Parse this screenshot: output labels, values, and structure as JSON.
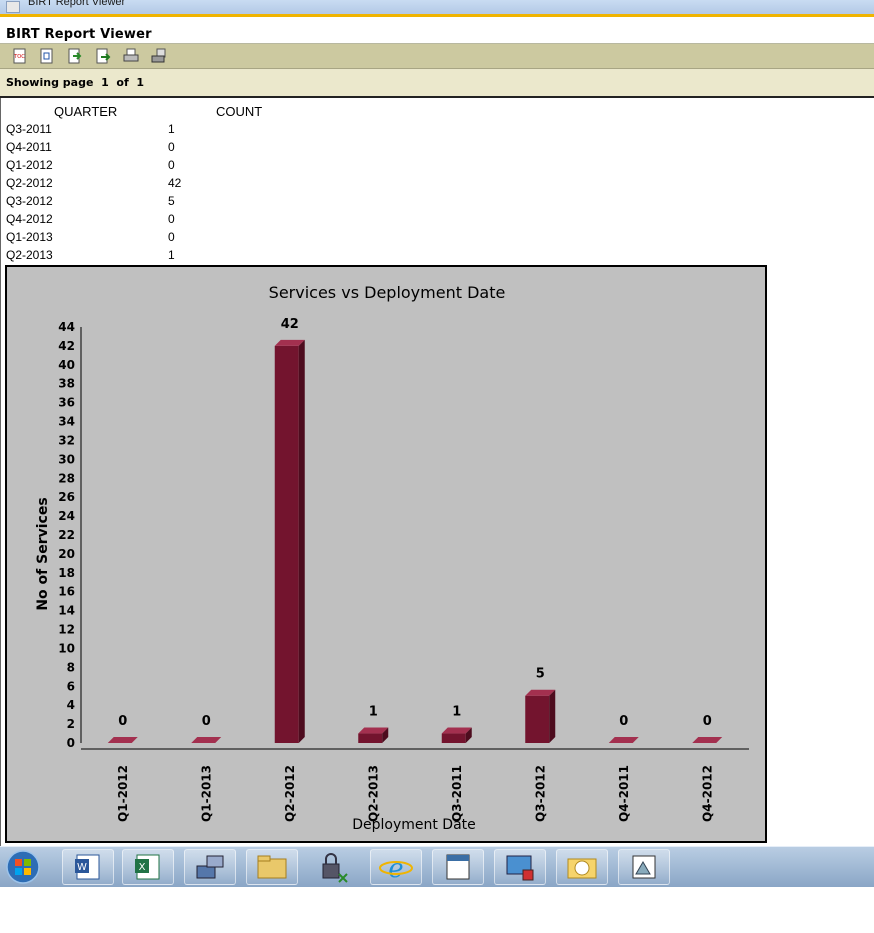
{
  "window": {
    "title": "BIRT Report Viewer"
  },
  "header": {
    "title": "BIRT Report Viewer"
  },
  "toolbar": {
    "buttons": [
      {
        "icon": "toc-icon"
      },
      {
        "icon": "parameters-icon"
      },
      {
        "icon": "export-data-icon"
      },
      {
        "icon": "export-report-icon"
      },
      {
        "icon": "print-icon"
      },
      {
        "icon": "print-server-icon"
      }
    ]
  },
  "pagebar": {
    "text": "Showing page  1  of  1"
  },
  "table": {
    "headers": {
      "quarter": "QUARTER",
      "count": "COUNT"
    },
    "rows": [
      {
        "quarter": "Q3-2011",
        "count": "1"
      },
      {
        "quarter": "Q4-2011",
        "count": "0"
      },
      {
        "quarter": "Q1-2012",
        "count": "0"
      },
      {
        "quarter": "Q2-2012",
        "count": "42"
      },
      {
        "quarter": "Q3-2012",
        "count": "5"
      },
      {
        "quarter": "Q4-2012",
        "count": "0"
      },
      {
        "quarter": "Q1-2013",
        "count": "0"
      },
      {
        "quarter": "Q2-2013",
        "count": "1"
      }
    ]
  },
  "chart_data": {
    "type": "bar",
    "title": "Services vs Deployment Date",
    "xlabel": "Deployment Date",
    "ylabel": "No of Services",
    "categories": [
      "Q1-2012",
      "Q1-2013",
      "Q2-2012",
      "Q2-2013",
      "Q3-2011",
      "Q3-2012",
      "Q4-2011",
      "Q4-2012"
    ],
    "values": [
      0,
      0,
      42,
      1,
      1,
      5,
      0,
      0
    ],
    "ylim": [
      0,
      44
    ],
    "yticks": [
      "0",
      "2",
      "4",
      "6",
      "8",
      "10",
      "12",
      "14",
      "16",
      "18",
      "20",
      "22",
      "24",
      "26",
      "28",
      "30",
      "32",
      "34",
      "36",
      "38",
      "40",
      "42",
      "44"
    ],
    "bar_color": "#73142e",
    "background": "#c0c0c0",
    "grid": false,
    "legend": "none"
  },
  "taskbar": {
    "apps": [
      {
        "icon": "word-icon"
      },
      {
        "icon": "excel-icon"
      },
      {
        "icon": "network-tool-icon"
      },
      {
        "icon": "file-explorer-icon"
      },
      {
        "icon": "security-lock-icon"
      },
      {
        "icon": "internet-explorer-icon"
      },
      {
        "icon": "text-editor-icon"
      },
      {
        "icon": "remote-desktop-icon"
      },
      {
        "icon": "outlook-icon"
      },
      {
        "icon": "report-designer-icon"
      }
    ]
  }
}
